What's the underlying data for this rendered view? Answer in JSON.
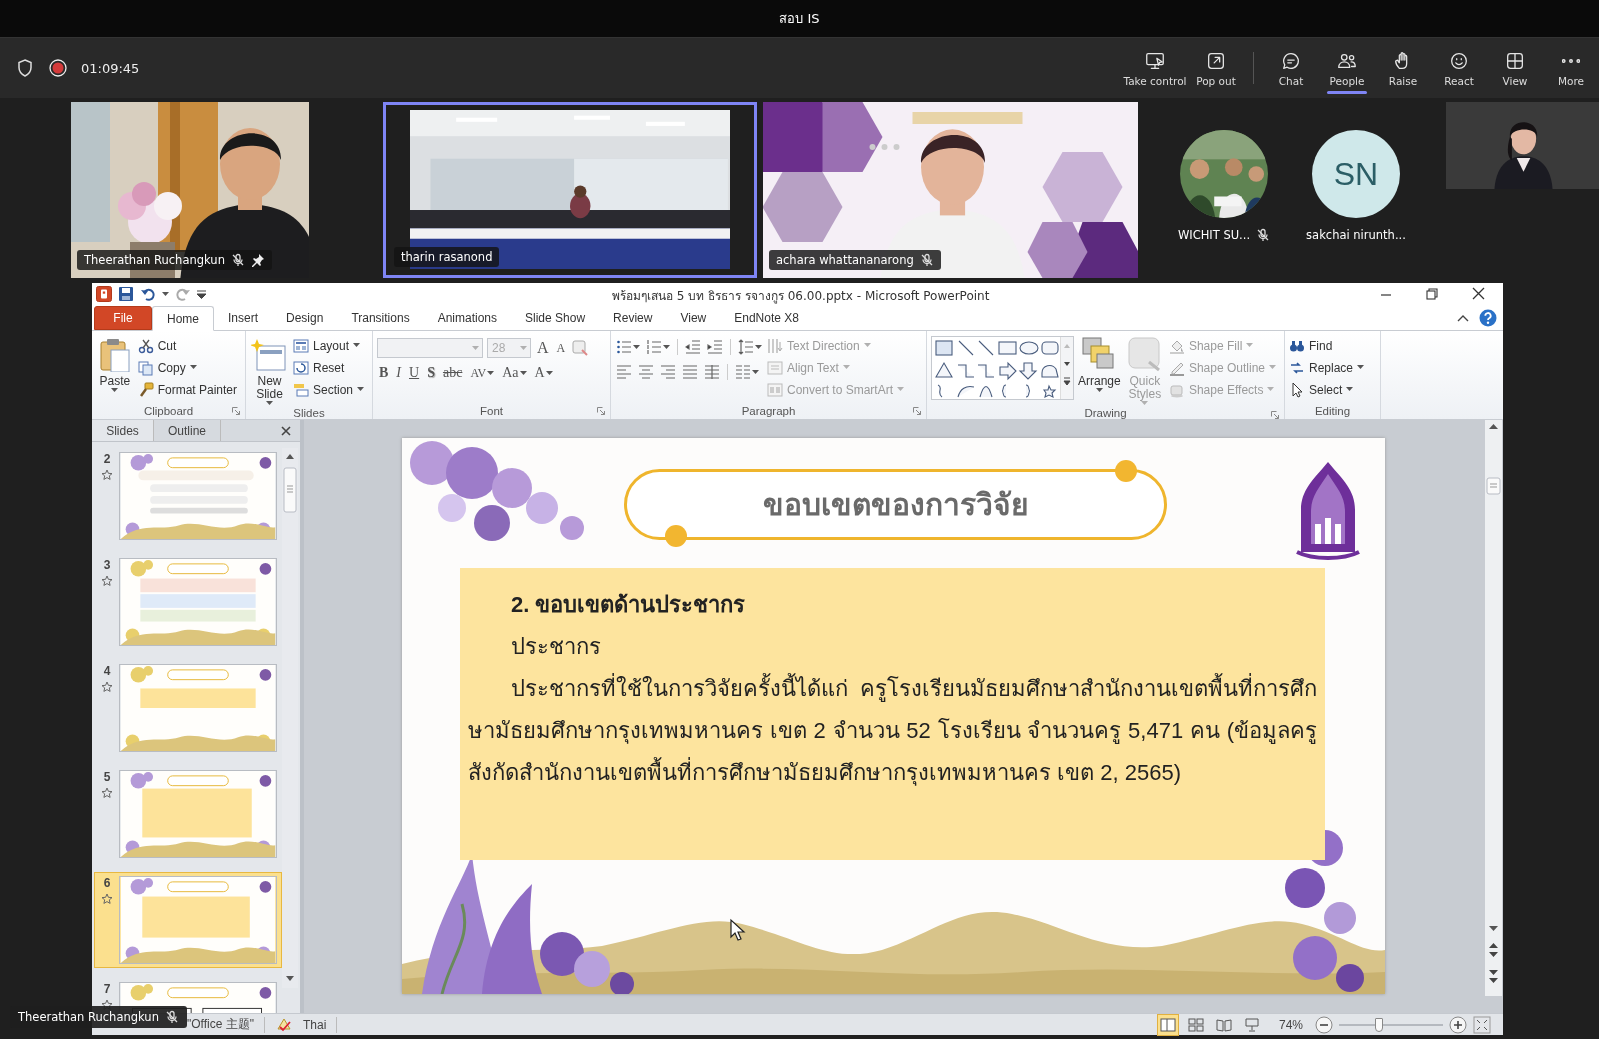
{
  "meeting": {
    "title": "สอบ IS",
    "timer": "01:09:45",
    "recording": true,
    "actions": [
      {
        "label": "Take control",
        "separated": false,
        "selected": false
      },
      {
        "label": "Pop out",
        "separated": false,
        "selected": false
      },
      {
        "label": "Chat",
        "separated": true,
        "selected": false
      },
      {
        "label": "People",
        "separated": false,
        "selected": true
      },
      {
        "label": "Raise",
        "separated": false,
        "selected": false
      },
      {
        "label": "React",
        "separated": false,
        "selected": false
      },
      {
        "label": "View",
        "separated": false,
        "selected": false
      },
      {
        "label": "More",
        "separated": false,
        "selected": false
      }
    ]
  },
  "participants": [
    {
      "kind": "video",
      "name": "Theerathan Ruchangkun",
      "muted": true,
      "pinned": true,
      "speaking": false
    },
    {
      "kind": "video",
      "name": "tharin rasanond",
      "muted": false,
      "pinned": false,
      "speaking": true
    },
    {
      "kind": "video",
      "name": "achara whattananarong",
      "muted": true,
      "pinned": false,
      "speaking": false
    },
    {
      "name": "WICHIT SU...",
      "muted": true
    },
    {
      "kind": "initials",
      "initials": "SN",
      "name": "sakchai nirunth...",
      "muted": false
    },
    {
      "kind": "self"
    }
  ],
  "powerpoint": {
    "title": "พร้อมๆเสนอ 5 บท ธิรธาร รจางกูร 06.00.pptx - Microsoft PowerPoint",
    "tabs": [
      {
        "label": "File",
        "kind": "file",
        "selected": false
      },
      {
        "label": "Home",
        "kind": "tab",
        "selected": true
      },
      {
        "label": "Insert",
        "kind": "tab",
        "selected": false
      },
      {
        "label": "Design",
        "kind": "tab",
        "selected": false
      },
      {
        "label": "Transitions",
        "kind": "tab",
        "selected": false
      },
      {
        "label": "Animations",
        "kind": "tab",
        "selected": false
      },
      {
        "label": "Slide Show",
        "kind": "tab",
        "selected": false
      },
      {
        "label": "Review",
        "kind": "tab",
        "selected": false
      },
      {
        "label": "View",
        "kind": "tab",
        "selected": false
      },
      {
        "label": "EndNote X8",
        "kind": "tab",
        "selected": false
      }
    ],
    "ribbon": [
      {
        "kind": "clipboard",
        "label": "Clipboard",
        "launcher": true,
        "large": [
          {
            "label": "Paste",
            "dropdown": true,
            "disabled": false
          }
        ],
        "small": [
          {
            "label": "Cut",
            "dropdown": false,
            "disabled": false
          },
          {
            "label": "Copy",
            "dropdown": true,
            "disabled": false
          },
          {
            "label": "Format Painter",
            "dropdown": false,
            "disabled": false
          }
        ]
      },
      {
        "kind": "slides",
        "label": "Slides",
        "launcher": false,
        "large": [
          {
            "label": "New Slide",
            "dropdown": true,
            "disabled": false
          }
        ],
        "small": [
          {
            "label": "Layout",
            "dropdown": true,
            "disabled": false
          },
          {
            "label": "Reset",
            "dropdown": false,
            "disabled": false
          },
          {
            "label": "Section",
            "dropdown": true,
            "disabled": false
          }
        ]
      },
      {
        "kind": "font",
        "label": "Font",
        "launcher": true,
        "size": "28",
        "fields_disabled": true,
        "sizers": [
          {
            "label": "A",
            "kind": "grow"
          },
          {
            "label": "A",
            "kind": "shrink"
          }
        ],
        "formats": [
          {
            "label": "B",
            "kind": "bold",
            "dropdown": false
          },
          {
            "label": "I",
            "kind": "italic",
            "dropdown": false
          },
          {
            "label": "U",
            "kind": "underline",
            "dropdown": false
          },
          {
            "label": "S",
            "kind": "shadow",
            "dropdown": false
          },
          {
            "label": "abc",
            "kind": "strike",
            "dropdown": false
          },
          {
            "label": "AV",
            "kind": "spacing",
            "dropdown": true
          },
          {
            "label": "Aa",
            "kind": "case",
            "dropdown": true
          },
          {
            "label": "A",
            "kind": "color",
            "dropdown": true
          }
        ]
      },
      {
        "kind": "paragraph",
        "label": "Paragraph",
        "launcher": true,
        "small": [
          {
            "label": "Text Direction",
            "dropdown": true,
            "disabled": true
          },
          {
            "label": "Align Text",
            "dropdown": true,
            "disabled": true
          },
          {
            "label": "Convert to SmartArt",
            "dropdown": true,
            "disabled": true
          }
        ]
      },
      {
        "kind": "drawing",
        "label": "Drawing",
        "launcher": true,
        "large": [
          {
            "label": "Arrange",
            "dropdown": true,
            "disabled": false
          },
          {
            "label": "Quick Styles",
            "dropdown": true,
            "disabled": true
          }
        ],
        "small": [
          {
            "label": "Shape Fill",
            "dropdown": true,
            "disabled": true
          },
          {
            "label": "Shape Outline",
            "dropdown": true,
            "disabled": true
          },
          {
            "label": "Shape Effects",
            "dropdown": true,
            "disabled": true
          }
        ]
      },
      {
        "kind": "editing",
        "label": "Editing",
        "launcher": false,
        "small": [
          {
            "label": "Find",
            "dropdown": false,
            "disabled": false
          },
          {
            "label": "Replace",
            "dropdown": true,
            "disabled": false
          },
          {
            "label": "Select",
            "dropdown": true,
            "disabled": false
          }
        ]
      }
    ],
    "pane": {
      "tabs": [
        {
          "label": "Slides",
          "selected": true
        },
        {
          "label": "Outline",
          "selected": false
        }
      ],
      "thumbnails": [
        {
          "number": "2",
          "kind": "lavender",
          "selected": false
        },
        {
          "number": "3",
          "kind": "gold",
          "selected": false
        },
        {
          "number": "4",
          "kind": "gold",
          "selected": false
        },
        {
          "number": "5",
          "kind": "lavender",
          "selected": false
        },
        {
          "number": "6",
          "kind": "lavender",
          "selected": true
        },
        {
          "number": "7",
          "kind": "gold",
          "selected": false
        }
      ]
    },
    "slide": {
      "title": "ขอบเขตของการวิจัย",
      "heading": "2. ขอบเขตด้านประชากร",
      "subheading": "ประชากร",
      "paragraph": "ประชากรที่ใช้ในการวิจัยครั้งนี้ได้แก่ ครูโรงเรียนมัธยมศึกษาสำนักงานเขตพื้นที่การศึกษามัธยมศึกษากรุงเทพมหานคร เขต 2 จำนวน 52 โรงเรียน จำนวนครู 5,471 คน (ข้อมูลครูสังกัดสำนักงานเขตพื้นที่การศึกษามัธยมศึกษากรุงเทพมหานคร เขต 2, 2565)"
    },
    "status": {
      "theme": "\"Office 主题\"",
      "language": "Thai",
      "views": [
        {
          "selected": true
        },
        {
          "selected": false
        },
        {
          "selected": false
        },
        {
          "selected": false
        }
      ],
      "zoom": "74%",
      "zoom_slider": {
        "level": 0.38
      }
    }
  },
  "presenter": {
    "name": "Theerathan Ruchangkun",
    "muted": true
  }
}
